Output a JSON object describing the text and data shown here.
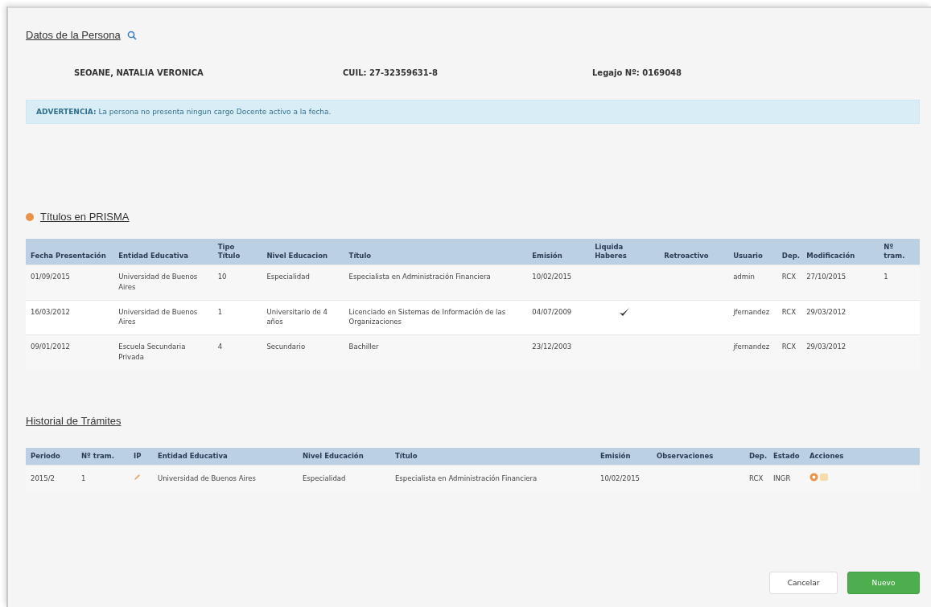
{
  "person_section": {
    "title": "Datos de la Persona",
    "name": "SEOANE, NATALIA VERONICA",
    "cuil": "CUIL: 27-32359631-8",
    "legajo": "Legajo Nº: 0169048"
  },
  "alert": {
    "label": "ADVERTENCIA:",
    "text": "La persona no presenta ningun cargo Docente activo a la fecha."
  },
  "titulos": {
    "title": "Títulos en PRISMA",
    "columns": [
      "Fecha Presentación",
      "Entidad Educativa",
      "Tipo Título",
      "Nivel Educacion",
      "Título",
      "Emisión",
      "Liquida Haberes",
      "Retroactivo",
      "Usuario",
      "Dep.",
      "Modificación",
      "Nº tram."
    ],
    "rows": [
      {
        "fecha": "01/09/2015",
        "entidad": "Universidad de Buenos Aires",
        "tipo": "10",
        "nivel": "Especialidad",
        "titulo": "Especialista en Administración Financiera",
        "emision": "10/02/2015",
        "liquida_haberes": false,
        "usuario": "admin",
        "dep": "RCX",
        "modificacion": "27/10/2015",
        "tram": "1"
      },
      {
        "fecha": "16/03/2012",
        "entidad": "Universidad de Buenos Aires",
        "tipo": "1",
        "nivel": "Universitario de 4 años",
        "titulo": "Licenciado en Sistemas de Información de las Organizaciones",
        "emision": "04/07/2009",
        "liquida_haberes": true,
        "usuario": "jfernandez",
        "dep": "RCX",
        "modificacion": "29/03/2012"
      },
      {
        "fecha": "09/01/2012",
        "entidad": "Escuela Secundaria Privada",
        "tipo": "4",
        "nivel": "Secundario",
        "titulo": "Bachiller",
        "emision": "23/12/2003",
        "liquida_haberes": false,
        "usuario": "jfernandez",
        "dep": "RCX",
        "modificacion": "29/03/2012"
      }
    ]
  },
  "historial": {
    "title": "Historial de Trámites",
    "columns": [
      "Periodo",
      "Nº tram.",
      "IP",
      "Entidad Educativa",
      "Nivel Educación",
      "Título",
      "Emisión",
      "Observaciones",
      "Dep.",
      "Estado",
      "Acciones"
    ],
    "rows": [
      {
        "periodo": "2015/2",
        "tram": "1",
        "entidad": "Universidad de Buenos Aires",
        "nivel": "Especialidad",
        "titulo": "Especialista en Administración Financiera",
        "emision": "10/02/2015",
        "dep": "RCX",
        "estado": "INGR"
      }
    ]
  },
  "buttons": [
    {
      "kind": "default",
      "label": "Cancelar"
    },
    {
      "kind": "primary",
      "label": "Nuevo"
    }
  ]
}
